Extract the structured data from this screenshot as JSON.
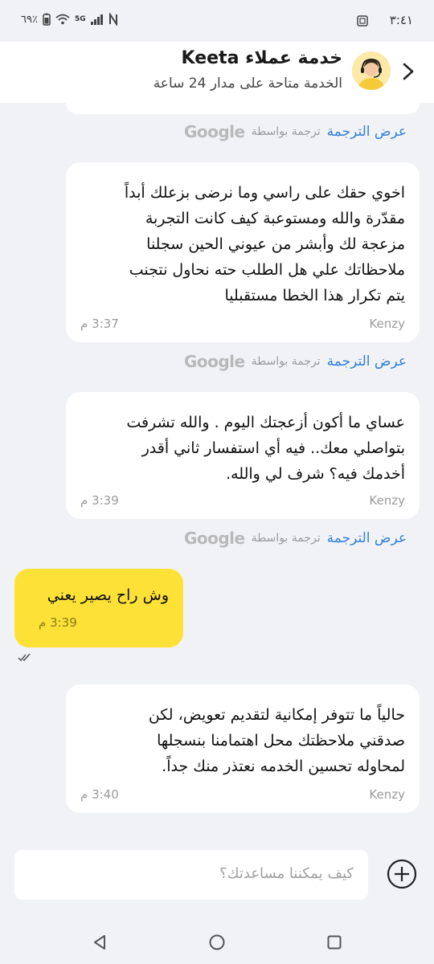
{
  "status_bar": {
    "time": "٣:٤١",
    "battery": "٦٩٪",
    "network": "5G"
  },
  "header": {
    "title": "خدمة عملاء Keeta",
    "subtitle": "الخدمة متاحة على مدار 24 ساعة"
  },
  "translation": {
    "view_label": "عرض الترجمة",
    "by_label": "ترجمة بواسطة",
    "provider": "Google"
  },
  "messages": [
    {
      "sender": "Kenzy",
      "text": "اخوي حقك على راسي وما نرضى بزعلك أبداً\nمقدّرة والله ومستوعبة كيف كانت التجربة\nمزعجة لك وأبشر من عيوني الحين سجلنا\nملاحظاتك علي هل الطلب حته نحاول نتجنب\nيتم تكرار هذا الخطا مستقبليا",
      "time": "3:37 م"
    },
    {
      "sender": "Kenzy",
      "text": "عساي ما أكون أزعجتك اليوم . والله تشرفت\nبتواصلي معك.. فيه أي استفسار ثاني أقدر\nأخدمك فيه؟ شرف لي والله.",
      "time": "3:39 م"
    },
    {
      "sender": "user",
      "text": "وش راح يصير يعني",
      "time": "3:39 م"
    },
    {
      "sender": "Kenzy",
      "text": "حالياً ما تتوفر إمكانية لتقديم تعويض، لكن\nصدقني ملاحظتك محل اهتمامنا بنسجلها\nلمحاوله تحسين الخدمه نعتذر منك جداً.",
      "time": "3:40 م"
    }
  ],
  "input": {
    "placeholder": "كيف يمكننا مساعدتك؟"
  },
  "colors": {
    "accent_yellow": "#fde137",
    "link_blue": "#2f7fd8",
    "background": "#f1f2f6"
  }
}
